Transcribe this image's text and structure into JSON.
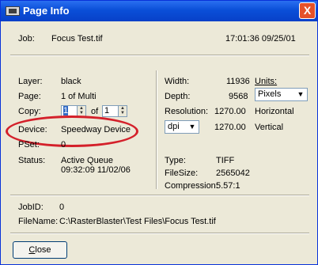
{
  "window": {
    "title": "Page Info",
    "close_glyph": "X"
  },
  "job": {
    "label": "Job:",
    "value": "Focus Test.tif",
    "timestamp": "17:01:36 09/25/01"
  },
  "left": {
    "layer_label": "Layer:",
    "layer_value": "black",
    "page_label": "Page:",
    "page_value": "1 of Multi",
    "copy_label": "Copy:",
    "copy_value": "1",
    "copy_of": "of",
    "copy_total": "1",
    "device_label": "Device:",
    "device_value": "Speedway Device",
    "pset_label": "PSet:",
    "pset_value": "0",
    "status_label": "Status:",
    "status_value_1": "Active Queue",
    "status_value_2": "09:32:09 11/02/06"
  },
  "right": {
    "width_label": "Width:",
    "width_value": "11936",
    "units_label": "Units:",
    "units_value": "Pixels",
    "depth_label": "Depth:",
    "depth_value": "9568",
    "resolution_label": "Resolution:",
    "res_h_value": "1270.00",
    "res_h_label": "Horizontal",
    "res_unit": "dpi",
    "res_v_value": "1270.00",
    "res_v_label": "Vertical",
    "type_label": "Type:",
    "type_value": "TIFF",
    "filesize_label": "FileSize:",
    "filesize_value": "2565042",
    "compression_label": "Compression:",
    "compression_value": "5.57:1"
  },
  "bottom": {
    "jobid_label": "JobID:",
    "jobid_value": "0",
    "filename_label": "FileName:",
    "filename_value": "C:\\RasterBlaster\\Test Files\\Focus Test.tif"
  },
  "buttons": {
    "close_label_accel": "C",
    "close_label_rest": "lose"
  },
  "colors": {
    "titlebar": "#0a4fd8",
    "dialog_bg": "#ece9d8",
    "highlight_ellipse": "#d4202a"
  }
}
